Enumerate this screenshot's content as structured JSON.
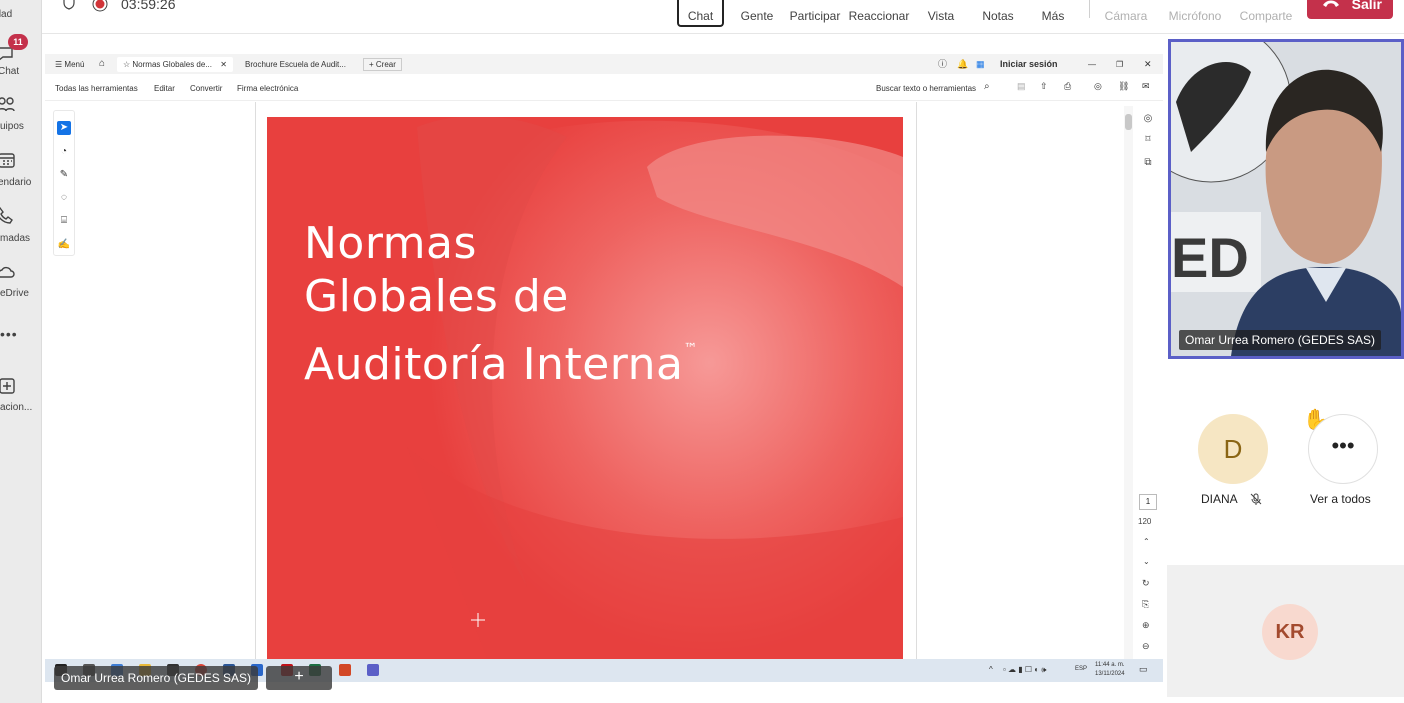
{
  "rail": {
    "items": [
      {
        "label": "ividad",
        "icon": "bell-icon"
      },
      {
        "label": "Chat",
        "icon": "chat-icon",
        "badge": "11"
      },
      {
        "label": "uipos",
        "icon": "teams-icon"
      },
      {
        "label": "endario",
        "icon": "calendar-icon"
      },
      {
        "label": "madas",
        "icon": "phone-icon"
      },
      {
        "label": "eDrive",
        "icon": "cloud-icon"
      },
      {
        "label": "",
        "icon": "more-icon"
      },
      {
        "label": "acion...",
        "icon": "add-app-icon"
      }
    ]
  },
  "meeting": {
    "timer": "03:59:26",
    "buttons": [
      {
        "label": "Chat",
        "active": true
      },
      {
        "label": "Gente"
      },
      {
        "label": "Participar"
      },
      {
        "label": "Reaccionar"
      },
      {
        "label": "Vista"
      },
      {
        "label": "Notas"
      },
      {
        "label": "Más"
      },
      {
        "label": "Cámara",
        "disabled": true
      },
      {
        "label": "Micrófono",
        "disabled": true
      },
      {
        "label": "Comparte",
        "disabled": true
      }
    ],
    "leave_label": "Salir"
  },
  "acrobat": {
    "menu_label": "Menú",
    "tab1": "Normas Globales de...",
    "tab2": "Brochure Escuela de Audit...",
    "create_label": "Crear",
    "signin_label": "Iniciar sesión",
    "tools": [
      "Todas las herramientas",
      "Editar",
      "Convertir",
      "Firma electrónica"
    ],
    "search_label": "Buscar texto o herramientas",
    "page_current": "1",
    "page_total": "120"
  },
  "document": {
    "title_line1": "Normas",
    "title_line2": "Globales de",
    "title_line3": "Auditoría Interna",
    "trademark": "™"
  },
  "taskbar": {
    "lang": "ESP",
    "time": "11:44 a. m.",
    "date": "13/11/2024"
  },
  "presenter_label": "Omar Urrea Romero (GEDES SAS)",
  "gallery": {
    "video_name": "Omar Urrea Romero (GEDES SAS)",
    "participant_d_initial": "D",
    "participant_d_name": "DIANA",
    "see_all_label": "Ver a todos",
    "participant_kr_initials": "KR"
  }
}
